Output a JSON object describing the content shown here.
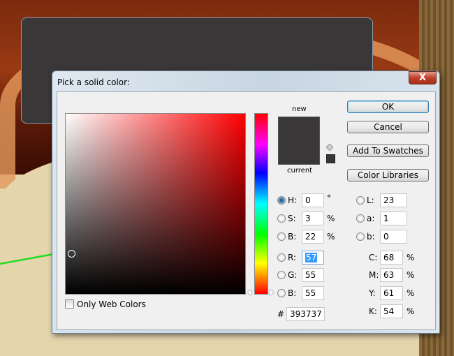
{
  "dialog": {
    "title": "Pick a solid color:",
    "close_label": "X"
  },
  "preview": {
    "new_label": "new",
    "current_label": "current",
    "new_color": "#393737",
    "current_color": "#393737"
  },
  "buttons": {
    "ok": "OK",
    "cancel": "Cancel",
    "add_to_swatches": "Add To Swatches",
    "color_libraries": "Color Libraries"
  },
  "only_web_colors": {
    "label": "Only Web Colors",
    "checked": false
  },
  "hsb": [
    {
      "label": "H:",
      "value": "0",
      "unit": "°",
      "selected": true
    },
    {
      "label": "S:",
      "value": "3",
      "unit": "%",
      "selected": false
    },
    {
      "label": "B:",
      "value": "22",
      "unit": "%",
      "selected": false
    }
  ],
  "rgb": [
    {
      "label": "R:",
      "value": "57"
    },
    {
      "label": "G:",
      "value": "55"
    },
    {
      "label": "B:",
      "value": "55"
    }
  ],
  "lab": [
    {
      "label": "L:",
      "value": "23"
    },
    {
      "label": "a:",
      "value": "1"
    },
    {
      "label": "b:",
      "value": "0"
    }
  ],
  "cmyk": [
    {
      "label": "C:",
      "value": "68",
      "unit": "%"
    },
    {
      "label": "M:",
      "value": "63",
      "unit": "%"
    },
    {
      "label": "Y:",
      "value": "61",
      "unit": "%"
    },
    {
      "label": "K:",
      "value": "54",
      "unit": "%"
    }
  ],
  "hex": {
    "label": "#",
    "value": "393737"
  },
  "colors": {
    "hue_base": "#ff0000",
    "annotation_arrow": "#22dd22"
  }
}
